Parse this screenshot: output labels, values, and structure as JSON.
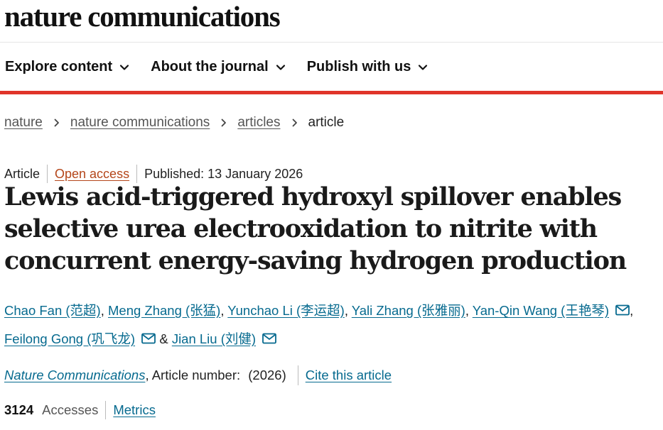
{
  "header": {
    "brand": "nature communications"
  },
  "nav": {
    "items": [
      {
        "label": "Explore content"
      },
      {
        "label": "About the journal"
      },
      {
        "label": "Publish with us"
      }
    ]
  },
  "breadcrumb": {
    "items": [
      "nature",
      "nature communications",
      "articles"
    ],
    "current": "article"
  },
  "article": {
    "type": "Article",
    "access": "Open access",
    "published": "Published: 13 January 2026",
    "title": "Lewis acid-triggered hydroxyl spillover enables selective urea electrooxidation to nitrite with concurrent energy-saving hydrogen production",
    "authors": [
      {
        "name": "Chao Fan (范超)"
      },
      {
        "name": "Meng Zhang (张猛)"
      },
      {
        "name": "Yunchao Li (李运超)"
      },
      {
        "name": "Yali Zhang (张雅丽)"
      },
      {
        "name": "Yan-Qin Wang (王艳琴)"
      },
      {
        "name": "Feilong Gong (巩飞龙)"
      },
      {
        "name": "Jian Liu (刘健)"
      }
    ],
    "author_sep": ",",
    "author_and": "&",
    "journal": "Nature Communications",
    "article_number_label": ", Article number: ",
    "article_year": "(2026)",
    "cite_label": "Cite this article",
    "accesses_count": "3124",
    "accesses_label": "Accesses",
    "metrics_label": "Metrics"
  },
  "colors": {
    "accent_red": "#e0342a",
    "link": "#066a8f",
    "open_access": "#b4461a"
  },
  "icons": {
    "nav_chevron": "chevron-down-icon",
    "breadcrumb_sep": "chevron-right-icon",
    "author_contact": "mail-icon"
  }
}
